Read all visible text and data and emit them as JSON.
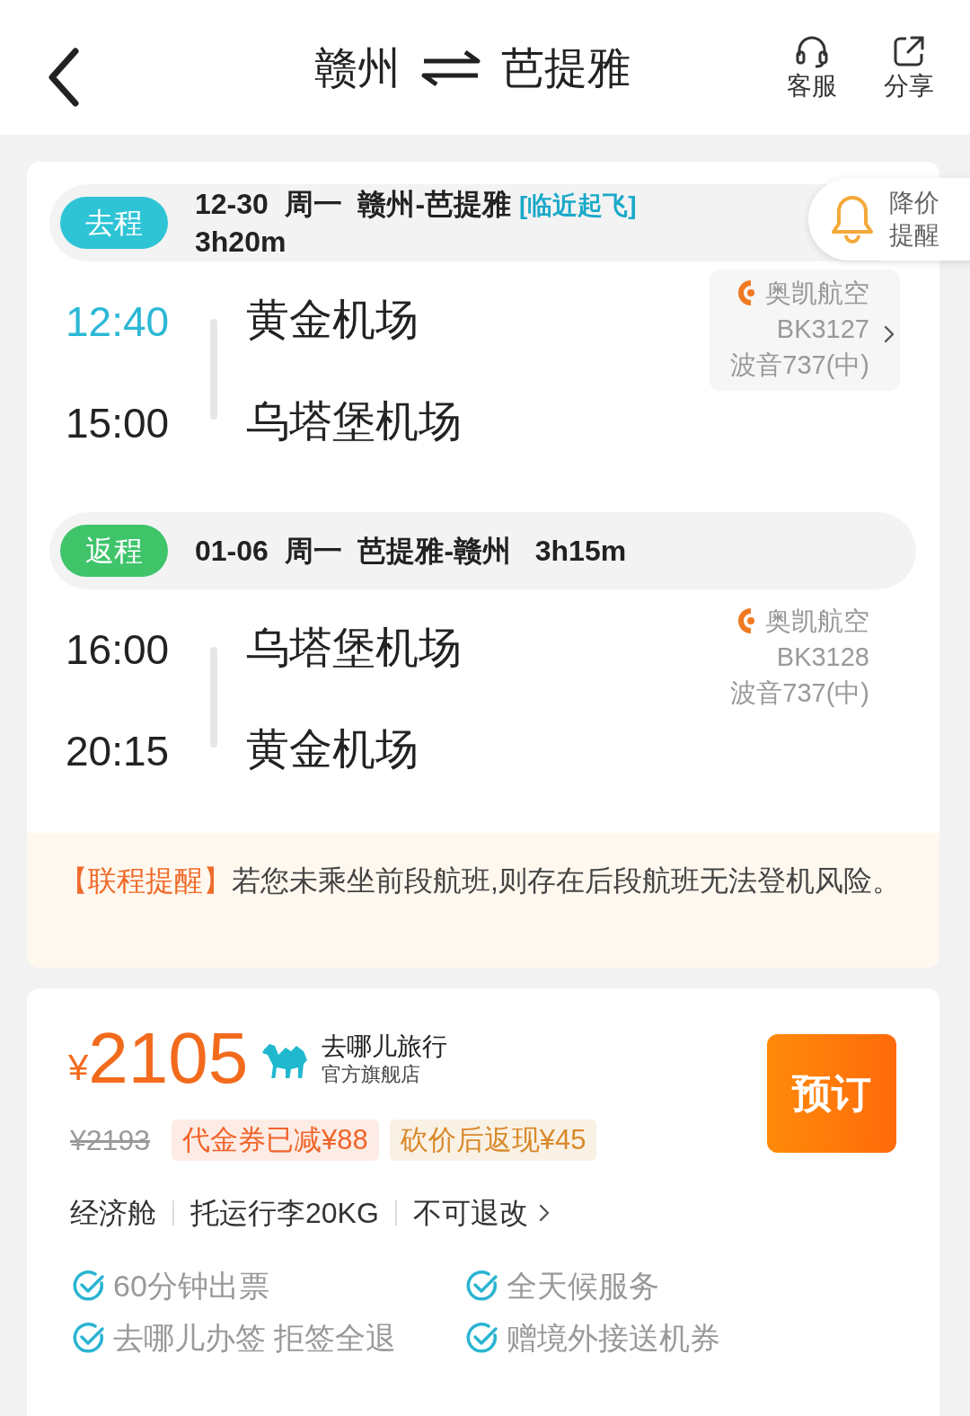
{
  "header": {
    "from": "赣州",
    "to": "芭提雅",
    "actions": [
      {
        "kind": "headset",
        "label": "客服"
      },
      {
        "kind": "share",
        "label": "分享"
      }
    ]
  },
  "price_alert": {
    "lines": [
      "降价",
      "提醒"
    ]
  },
  "legs": [
    {
      "badge": "去程",
      "color": "#2ec4d6",
      "summary": "12-30  周一  赣州-芭提雅",
      "tag": "[临近起飞]",
      "duration": "3h20m",
      "dep_time": "12:40",
      "dep_highlight": true,
      "arr_time": "15:00",
      "dep_airport": "黄金机场",
      "arr_airport": "乌塔堡机场",
      "airline": "奥凯航空",
      "flight_no": "BK3127",
      "aircraft": "波音737(中)",
      "expandable": true
    },
    {
      "badge": "返程",
      "color": "#3fc46a",
      "summary": "01-06  周一  芭提雅-赣州",
      "duration": "3h15m",
      "dep_time": "16:00",
      "dep_highlight": false,
      "arr_time": "20:15",
      "dep_airport": "乌塔堡机场",
      "arr_airport": "黄金机场",
      "airline": "奥凯航空",
      "flight_no": "BK3128",
      "aircraft": "波音737(中)",
      "expandable": false
    }
  ],
  "notice": {
    "title": "【联程提醒】",
    "text": "若您未乘坐前段航班,则存在后段航班无法登机风险。"
  },
  "offer": {
    "currency": "¥",
    "amount": "2105",
    "seller": "去哪儿旅行",
    "seller_sub": "官方旗舰店",
    "original_price": "¥2193",
    "discounts": [
      {
        "text": "代金券已减¥88",
        "color": "#f0642a"
      },
      {
        "text": "砍价后返现¥45",
        "color": "#d9892a"
      }
    ],
    "book": "预订",
    "terms": [
      {
        "text": "经济舱",
        "link": false
      },
      {
        "text": "托运行李20KG",
        "link": false
      },
      {
        "text": "不可退改",
        "link": true
      }
    ],
    "guarantees": [
      "60分钟出票",
      "全天候服务",
      "去哪儿办签 拒签全退",
      "赠境外接送机券"
    ]
  }
}
